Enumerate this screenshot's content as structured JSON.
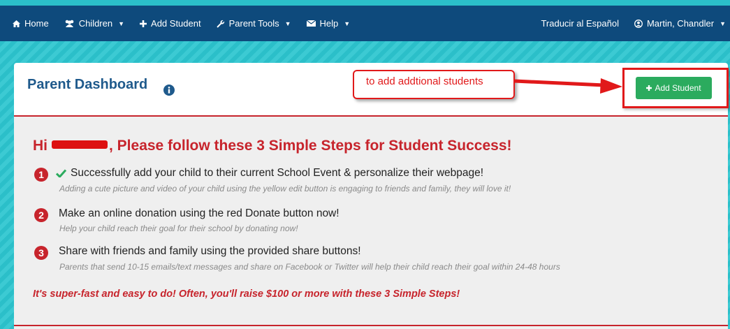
{
  "navbar": {
    "home": "Home",
    "children": "Children",
    "add_student": "Add Student",
    "parent_tools": "Parent Tools",
    "help": "Help",
    "translate": "Traducir al Español",
    "user": "Martin, Chandler"
  },
  "panel": {
    "title": "Parent Dashboard",
    "annotation": "to add addtional students",
    "add_student_button": "Add Student"
  },
  "greeting": {
    "prefix": "Hi",
    "suffix": ", Please follow these 3 Simple Steps for Student Success!"
  },
  "steps": [
    {
      "number": "1",
      "text": "Successfully add your child to their current School Event & personalize their webpage!",
      "sub": "Adding a cute picture and video of your child using the yellow edit button is engaging to friends and family, they will love it!"
    },
    {
      "number": "2",
      "text": "Make an online donation using the red Donate button now!",
      "sub": "Help your child reach their goal for their school by donating now!"
    },
    {
      "number": "3",
      "text": "Share with friends and family using the provided share buttons!",
      "sub": "Parents that send 10-15 emails/text messages and share on Facebook or Twitter will help their child reach their goal within 24-48 hours"
    }
  ],
  "closing": "It's super-fast and easy to do! Often, you'll raise $100 or more with these 3 Simple Steps!",
  "colors": {
    "navbar": "#0e4a7c",
    "teal": "#2bbfc9",
    "accent_red": "#c7242c",
    "button_green": "#2bab5e",
    "annotation_red": "#e1191a"
  },
  "icons": {
    "home": "home-icon",
    "children": "users-icon",
    "add": "plus-icon",
    "tools": "wrench-icon",
    "help": "envelope-icon",
    "user": "user-circle-icon",
    "info": "info-icon",
    "check": "check-icon"
  }
}
